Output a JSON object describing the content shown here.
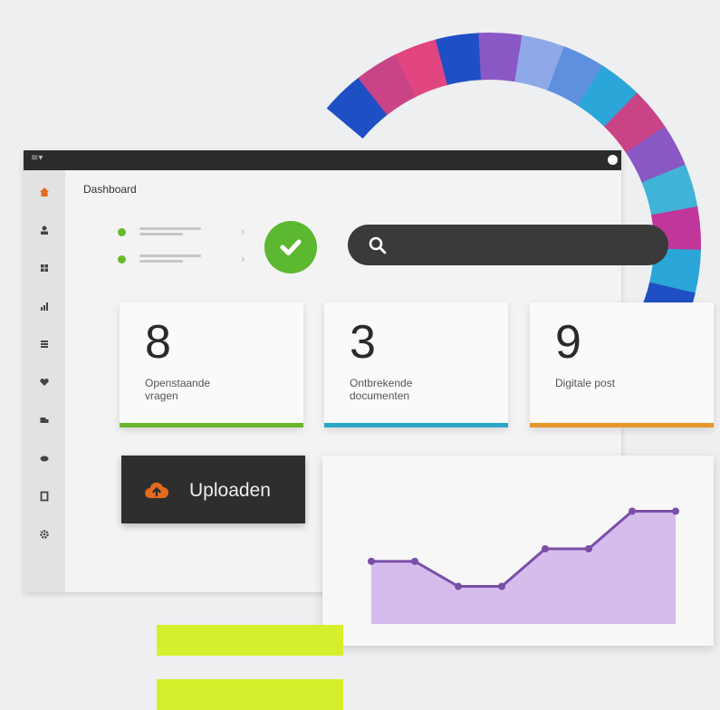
{
  "window": {
    "menu_glyph": "≡▾",
    "breadcrumb": "Dashboard"
  },
  "sidebar": {
    "items": [
      {
        "icon": "home-icon",
        "color": "#e26b1e",
        "active": true
      },
      {
        "icon": "user-icon"
      },
      {
        "icon": "grid-icon"
      },
      {
        "icon": "bar-chart-icon"
      },
      {
        "icon": "list-icon"
      },
      {
        "icon": "heart-icon"
      },
      {
        "icon": "truck-icon"
      },
      {
        "icon": "piggy-bank-icon"
      },
      {
        "icon": "document-icon"
      },
      {
        "icon": "gear-icon"
      }
    ]
  },
  "checklist": {
    "items": [
      {
        "status": "done"
      },
      {
        "status": "done"
      }
    ],
    "chevron": "›"
  },
  "status_check": {
    "icon": "check-circle-icon",
    "color": "#5cb830"
  },
  "search": {
    "placeholder": "",
    "icon": "search-icon"
  },
  "cards": [
    {
      "value": "8",
      "label": "Openstaande vragen",
      "accent": "#6ab52c"
    },
    {
      "value": "3",
      "label": "Ontbrekende documenten",
      "accent": "#2aa6c8"
    },
    {
      "value": "9",
      "label": "Digitale post",
      "accent": "#e8962a"
    }
  ],
  "upload_button": {
    "label": "Uploaden",
    "icon": "cloud-upload-icon",
    "icon_color": "#e26b1e"
  },
  "chart_data": {
    "type": "area",
    "x": [
      1,
      2,
      3,
      4,
      5,
      6,
      7,
      8
    ],
    "values": [
      5,
      5,
      3,
      3,
      6,
      6,
      9,
      9
    ],
    "ylim": [
      0,
      12
    ],
    "fill": "#d6bcec",
    "line": "#7a4fa8"
  },
  "colors": {
    "ring_segments": [
      "#1f4fc4",
      "#c84487",
      "#e0457f",
      "#1f4fc4",
      "#8a58c4",
      "#8fa9e8",
      "#5f90e0",
      "#2aa6d8",
      "#c84487",
      "#8a58c4",
      "#3fb3d8",
      "#c0369a",
      "#2aa6d8",
      "#1f4fc4"
    ],
    "highlight": "#d6ef2c"
  }
}
